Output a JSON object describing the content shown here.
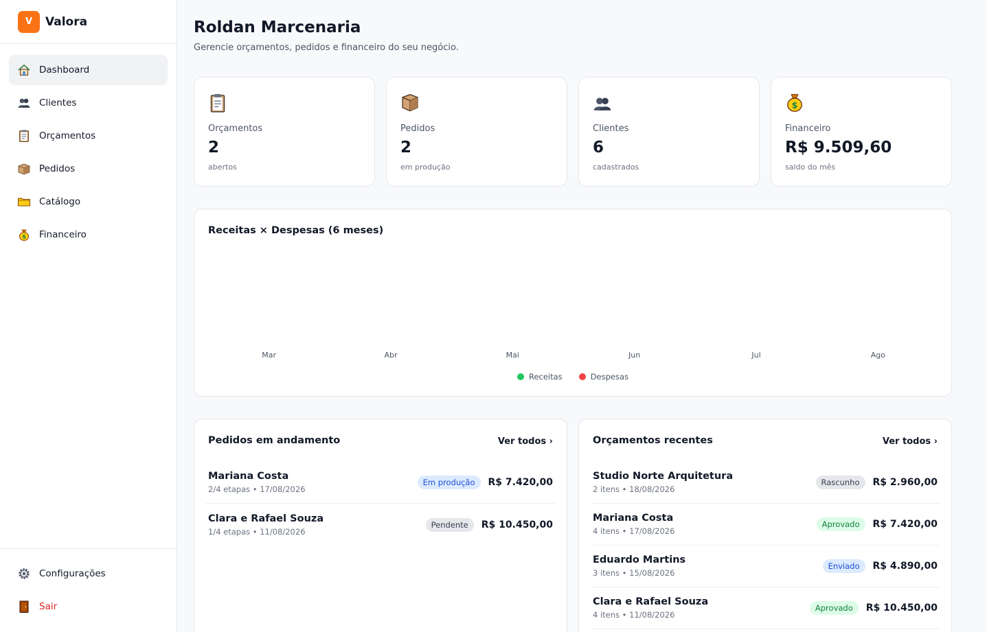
{
  "brand": {
    "logo_letter": "V",
    "name": "Valora",
    "accent": "#f97316"
  },
  "nav": {
    "items": [
      {
        "label": "Dashboard",
        "icon": "house-icon",
        "active": true
      },
      {
        "label": "Clientes",
        "icon": "people-icon"
      },
      {
        "label": "Orçamentos",
        "icon": "clipboard-icon"
      },
      {
        "label": "Pedidos",
        "icon": "package-icon"
      },
      {
        "label": "Catálogo",
        "icon": "folder-icon"
      },
      {
        "label": "Financeiro",
        "icon": "money-bag-icon"
      }
    ],
    "settings": {
      "label": "Configurações",
      "icon": "gear-icon"
    },
    "logout": {
      "label": "Sair",
      "icon": "door-icon",
      "color": "#dc2626"
    }
  },
  "header": {
    "title": "Roldan Marcenaria",
    "subtitle": "Gerencie orçamentos, pedidos e financeiro do seu negócio."
  },
  "stats": [
    {
      "label": "Orçamentos",
      "value": "2",
      "hint": "abertos",
      "icon": "clipboard-icon"
    },
    {
      "label": "Pedidos",
      "value": "2",
      "hint": "em produção",
      "icon": "package-icon"
    },
    {
      "label": "Clientes",
      "value": "6",
      "hint": "cadastrados",
      "icon": "people-icon"
    },
    {
      "label": "Financeiro",
      "value": "R$ 9.509,60",
      "hint": "saldo do mês",
      "icon": "money-bag-icon"
    }
  ],
  "chart": {
    "title": "Receitas × Despesas (6 meses)",
    "legend": [
      {
        "label": "Receitas",
        "color": "#22c55e"
      },
      {
        "label": "Despesas",
        "color": "#ef4444"
      }
    ]
  },
  "chart_data": {
    "type": "bar",
    "categories": [
      "Mar",
      "Abr",
      "Mai",
      "Jun",
      "Jul",
      "Ago"
    ],
    "series": [
      {
        "name": "Receitas",
        "values": [
          0,
          0,
          0,
          0,
          0,
          0
        ]
      },
      {
        "name": "Despesas",
        "values": [
          0,
          0,
          0,
          0,
          0,
          0
        ]
      }
    ],
    "title": "Receitas × Despesas (6 meses)",
    "grid": false,
    "legend_position": "bottom"
  },
  "orders": {
    "title": "Pedidos em andamento",
    "link": "Ver todos ›",
    "rows": [
      {
        "name": "Mariana Costa",
        "meta": "2/4 etapas • 17/08/2026",
        "status": "Em produção",
        "status_kind": "blue",
        "amount": "R$ 7.420,00"
      },
      {
        "name": "Clara e Rafael Souza",
        "meta": "1/4 etapas • 11/08/2026",
        "status": "Pendente",
        "status_kind": "gray",
        "amount": "R$ 10.450,00"
      }
    ]
  },
  "quotes": {
    "title": "Orçamentos recentes",
    "link": "Ver todos ›",
    "rows": [
      {
        "name": "Studio Norte Arquitetura",
        "meta": "2 itens • 18/08/2026",
        "status": "Rascunho",
        "status_kind": "gray",
        "amount": "R$ 2.960,00"
      },
      {
        "name": "Mariana Costa",
        "meta": "4 itens • 17/08/2026",
        "status": "Aprovado",
        "status_kind": "green",
        "amount": "R$ 7.420,00"
      },
      {
        "name": "Eduardo Martins",
        "meta": "3 itens • 15/08/2026",
        "status": "Enviado",
        "status_kind": "blue",
        "amount": "R$ 4.890,00"
      },
      {
        "name": "Clara e Rafael Souza",
        "meta": "4 itens • 11/08/2026",
        "status": "Aprovado",
        "status_kind": "green",
        "amount": "R$ 10.450,00"
      }
    ]
  }
}
